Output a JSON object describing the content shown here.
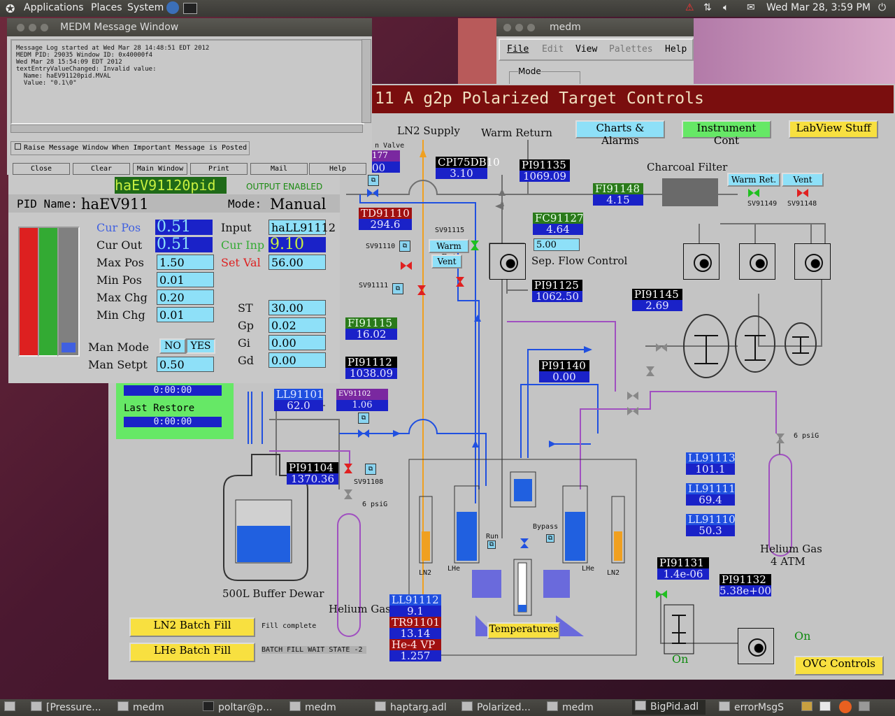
{
  "top_panel": {
    "menus": [
      "Applications",
      "Places",
      "System"
    ],
    "clock": "Wed Mar 28,  3:59 PM"
  },
  "msg_window": {
    "title": "MEDM Message Window",
    "log": "Message Log started at Wed Mar 28 14:48:51 EDT 2012\nMEDM PID: 29035 Window ID: 0x40000f4\nWed Mar 28 15:54:09 EDT 2012\ntextEntryValueChanged: Invalid value:\n  Name: haEV91120pid.MVAL\n  Value: \"0.1\\0\"",
    "raise_label": "Raise Message Window When Important Message is Posted",
    "buttons": [
      "Close",
      "Clear",
      "Main Window",
      "Print",
      "Mail",
      "Help"
    ]
  },
  "medm_main": {
    "title": "medm",
    "menus": [
      "File",
      "Edit",
      "View",
      "Palettes",
      "Help"
    ],
    "mode_label": "Mode"
  },
  "synoptic": {
    "header": "11 A g2p Polarized Target Controls",
    "buttons": {
      "charts": "Charts & Alarms",
      "instrument": "Instrument Cont",
      "labview": "LabView Stuff",
      "ovc": "OVC Controls",
      "temperatures": "Temperatures",
      "ln2_batch": "LN2 Batch Fill",
      "lhe_batch": "LHe Batch Fill",
      "warm_ret": "Warm Ret.",
      "vent": "Vent",
      "warm_ret2": "Warm Ret",
      "vent2": "Vent"
    },
    "labels": {
      "ln2_supply": "LN2 Supply",
      "warm_return": "Warm Return",
      "charcoal": "Charcoal Filter",
      "sep_flow": "Sep. Flow Control",
      "buffer_dewar": "500L Buffer Dewar",
      "helium_gas_left": "Helium Gas",
      "helium_gas_right": "Helium Gas",
      "four_atm": "4 ATM",
      "six_psig_a": "6 psiG",
      "six_psig_b": "6 psiG",
      "last_restore": "Last Restore",
      "time1": "0:00:00",
      "time2": "0:00:00",
      "fill_complete": "Fill complete",
      "batch_wait": "BATCH FILL WAIT STATE -2",
      "ln2_a": "LN2",
      "ln2_b": "LN2",
      "lhe_a": "LHe",
      "lhe_b": "LHe",
      "run": "Run",
      "bypass": "Bypass",
      "on1": "On",
      "on2": "On",
      "valve_frag": "n Valve",
      "sv91149": "SV91149",
      "sv91148": "SV91148",
      "sv91115": "SV91115",
      "sv91110": "SV91110",
      "sv91111": "SV91111",
      "sv91108": "SV91108",
      "flow_setpoint": "5.00",
      "frag_177": "177",
      "frag_00": "00"
    },
    "pvs": {
      "CPI75DB10": {
        "name": "CPI75DB10",
        "value": "3.10"
      },
      "PI91135": {
        "name": "PI91135",
        "value": "1069.09"
      },
      "FI91148": {
        "name": "FI91148",
        "value": "4.15"
      },
      "FC91127": {
        "name": "FC91127",
        "value": "4.64"
      },
      "TD91110": {
        "name": "TD91110",
        "value": "294.6"
      },
      "PI91125": {
        "name": "PI91125",
        "value": "1062.50"
      },
      "PI91145": {
        "name": "PI91145",
        "value": "2.69"
      },
      "FI91115": {
        "name": "FI91115",
        "value": "16.02"
      },
      "PI91112": {
        "name": "PI91112",
        "value": "1038.09"
      },
      "PI91140": {
        "name": "PI91140",
        "value": "0.00"
      },
      "LL91101": {
        "name": "LL91101",
        "value": "62.0"
      },
      "EV91102": {
        "name": "EV91102",
        "value": "1.06"
      },
      "PI91104": {
        "name": "PI91104",
        "value": "1370.36"
      },
      "LL91113": {
        "name": "LL91113",
        "value": "101.1"
      },
      "LL91111": {
        "name": "LL91111",
        "value": "69.4"
      },
      "LL91110": {
        "name": "LL91110",
        "value": "50.3"
      },
      "PI91131": {
        "name": "PI91131",
        "value": "1.4e-06"
      },
      "PI91132": {
        "name": "PI91132",
        "value": "5.38e+00"
      },
      "LL91112": {
        "name": "LL91112",
        "value": "9.1"
      },
      "TR91101": {
        "name": "TR91101",
        "value": "13.14"
      },
      "He4VP": {
        "name": "He-4 VP",
        "value": "1.257"
      }
    }
  },
  "pid": {
    "pv_name": "haEV91120pid",
    "status": "OUTPUT ENABLED",
    "pid_name_label": "PID Name:",
    "pid_name": "haEV911",
    "mode_label": "Mode:",
    "mode": "Manual",
    "fields": {
      "cur_pos": {
        "label": "Cur Pos",
        "value": "0.51"
      },
      "cur_out": {
        "label": "Cur Out",
        "value": "0.51"
      },
      "max_pos": {
        "label": "Max Pos",
        "value": "1.50"
      },
      "min_pos": {
        "label": "Min Pos",
        "value": "0.01"
      },
      "max_chg": {
        "label": "Max Chg",
        "value": "0.20"
      },
      "min_chg": {
        "label": "Min Chg",
        "value": "0.01"
      },
      "input": {
        "label": "Input",
        "value": "haLL91112"
      },
      "cur_inp": {
        "label": "Cur Inp",
        "value": "9.10"
      },
      "set_val": {
        "label": "Set Val",
        "value": "56.00"
      },
      "st": {
        "label": "ST",
        "value": "30.00"
      },
      "gp": {
        "label": "Gp",
        "value": "0.02"
      },
      "gi": {
        "label": "Gi",
        "value": "0.00"
      },
      "gd": {
        "label": "Gd",
        "value": "0.00"
      },
      "man_setpt": {
        "label": "Man Setpt",
        "value": "0.50"
      }
    },
    "man_mode_label": "Man Mode",
    "no": "NO",
    "yes": "YES",
    "bar_fill": 0.05
  },
  "taskbar": [
    "[Pressure...",
    "medm",
    "poltar@p...",
    "medm",
    "haptarg.adl",
    "Polarized...",
    "medm",
    "BigPid.adl",
    "errorMsgS"
  ],
  "colors": {
    "header": "#7a0e0e",
    "cyan": "#8ee0f8",
    "blue": "#1a22c8",
    "green_btn": "#66e866",
    "yellow_btn": "#f8e040"
  }
}
